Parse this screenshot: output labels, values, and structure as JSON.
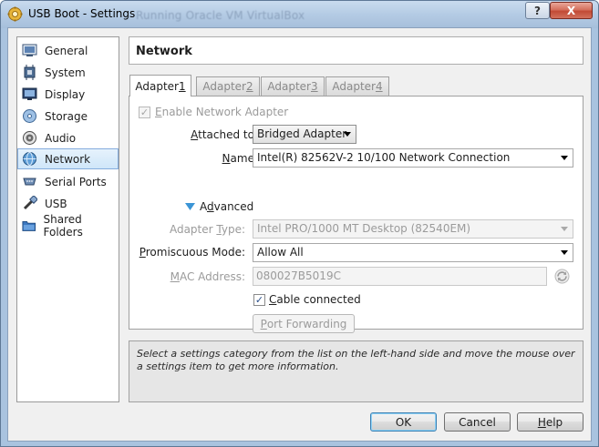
{
  "window": {
    "title": "USB Boot - Settings",
    "background_title": "Running     Oracle VM VirtualBox",
    "help_label": "?",
    "close_label": "X"
  },
  "sidebar": {
    "items": [
      {
        "label": "General",
        "icon": "general-icon"
      },
      {
        "label": "System",
        "icon": "system-icon"
      },
      {
        "label": "Display",
        "icon": "display-icon"
      },
      {
        "label": "Storage",
        "icon": "storage-icon"
      },
      {
        "label": "Audio",
        "icon": "audio-icon"
      },
      {
        "label": "Network",
        "icon": "network-icon",
        "selected": true
      },
      {
        "label": "Serial Ports",
        "icon": "serial-ports-icon"
      },
      {
        "label": "USB",
        "icon": "usb-icon"
      },
      {
        "label": "Shared Folders",
        "icon": "shared-folders-icon"
      }
    ]
  },
  "page": {
    "title": "Network",
    "tabs": [
      {
        "label": "Adapter ",
        "mnemonic": "1",
        "active": true
      },
      {
        "label": "Adapter ",
        "mnemonic": "2"
      },
      {
        "label": "Adapter ",
        "mnemonic": "3"
      },
      {
        "label": "Adapter ",
        "mnemonic": "4"
      }
    ]
  },
  "adapter": {
    "enable_label_pre": "",
    "enable_label_mn": "E",
    "enable_label_post": "nable Network Adapter",
    "attached_label_pre": "",
    "attached_label_mn": "A",
    "attached_label_post": "ttached to:",
    "attached_value": "Bridged Adapter",
    "name_label_pre": "",
    "name_label_mn": "N",
    "name_label_post": "ame:",
    "name_value": "Intel(R) 82562V-2 10/100 Network Connection",
    "advanced_label_pre": "A",
    "advanced_label_mn": "d",
    "advanced_label_post": "vanced",
    "adapter_type_label_pre": "Adapter ",
    "adapter_type_label_mn": "T",
    "adapter_type_label_post": "ype:",
    "adapter_type_value": "Intel PRO/1000 MT Desktop (82540EM)",
    "promiscuous_label_pre": "",
    "promiscuous_label_mn": "P",
    "promiscuous_label_post": "romiscuous Mode:",
    "promiscuous_value": "Allow All",
    "mac_label_pre": "",
    "mac_label_mn": "M",
    "mac_label_post": "AC Address:",
    "mac_value": "080027B5019C",
    "cable_label_pre": "",
    "cable_label_mn": "C",
    "cable_label_post": "able connected",
    "port_forwarding_pre": "",
    "port_forwarding_mn": "P",
    "port_forwarding_post": "ort Forwarding",
    "check_glyph": "✓"
  },
  "info": {
    "text": "Select a settings category from the list on the left-hand side and move the mouse over a settings item to get more information."
  },
  "buttons": {
    "ok": "OK",
    "cancel": "Cancel",
    "help_pre": "",
    "help_mn": "H",
    "help_post": "elp"
  }
}
